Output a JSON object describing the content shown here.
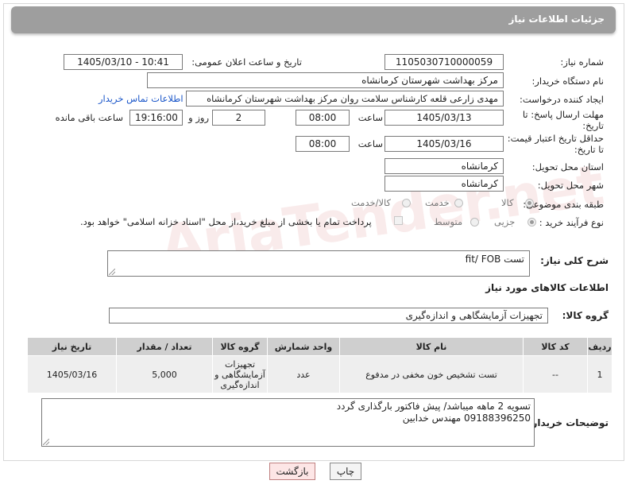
{
  "header": {
    "title": "جزئیات اطلاعات نیاز"
  },
  "fields": {
    "need_number_label": "شماره نیاز:",
    "need_number": "1105030710000059",
    "announce_label": "تاریخ و ساعت اعلان عمومی:",
    "announce_value": "1405/03/10 - 10:41",
    "buyer_org_label": "نام دستگاه خریدار:",
    "buyer_org": "مرکز بهداشت شهرستان کرمانشاه",
    "creator_label": "ایجاد کننده درخواست:",
    "creator": "مهدی  زارعی قلعه کارشناس سلامت روان مرکز بهداشت شهرستان کرمانشاه",
    "contact_link": "اطلاعات تماس خریدار",
    "deadline_label": "مهلت ارسال پاسخ: تا تاریخ:",
    "deadline_date": "1405/03/13",
    "time_word": "ساعت",
    "deadline_time": "08:00",
    "days": "2",
    "days_word": "روز و",
    "remaining_time": "19:16:00",
    "remaining_word": "ساعت باقی مانده",
    "min_price_label": "حداقل تاریخ اعتبار قیمت: تا تاریخ:",
    "price_date": "1405/03/16",
    "price_time": "08:00",
    "province_label": "استان محل تحویل:",
    "province": "کرمانشاه",
    "city_label": "شهر محل تحویل:",
    "city": "کرمانشاه",
    "category_label": "طبقه بندی موضوعی:",
    "category_options": [
      "کالا",
      "خدمت",
      "کالا/خدمت"
    ],
    "process_label": "نوع فرآیند خرید :",
    "process_options": [
      "جزیی",
      "متوسط"
    ],
    "payment_note": "پرداخت تمام یا بخشی از مبلغ خرید،از محل \"اسناد خزانه اسلامی\" خواهد بود.",
    "description_label": "شرح کلی نیاز:",
    "description": "تست fit/ FOB",
    "goods_info_label": "اطلاعات کالاهای مورد نیاز",
    "goods_group_label": "گروه کالا:",
    "goods_group": "تجهیزات آزمایشگاهی و اندازه‌گیری",
    "buyer_notes_label": "توضیحات خریدار:",
    "buyer_notes_line1": "تسویه 2 ماهه میباشد/ پیش فاکتور بارگذاری گردد",
    "buyer_notes_line2": "09188396250 مهندس خدابین"
  },
  "table": {
    "headers": [
      "ردیف",
      "کد کالا",
      "نام کالا",
      "واحد شمارش",
      "گروه کالا",
      "تعداد / مقدار",
      "تاریخ نیاز"
    ],
    "rows": [
      [
        "1",
        "--",
        "تست تشخیص خون مخفی در مدفوع",
        "عدد",
        "تجهیزات آزمایشگاهی و اندازه‌گیری",
        "5,000",
        "1405/03/16"
      ]
    ]
  },
  "buttons": {
    "print": "چاپ",
    "back": "بازگشت"
  },
  "watermark": "AriaTender.net"
}
